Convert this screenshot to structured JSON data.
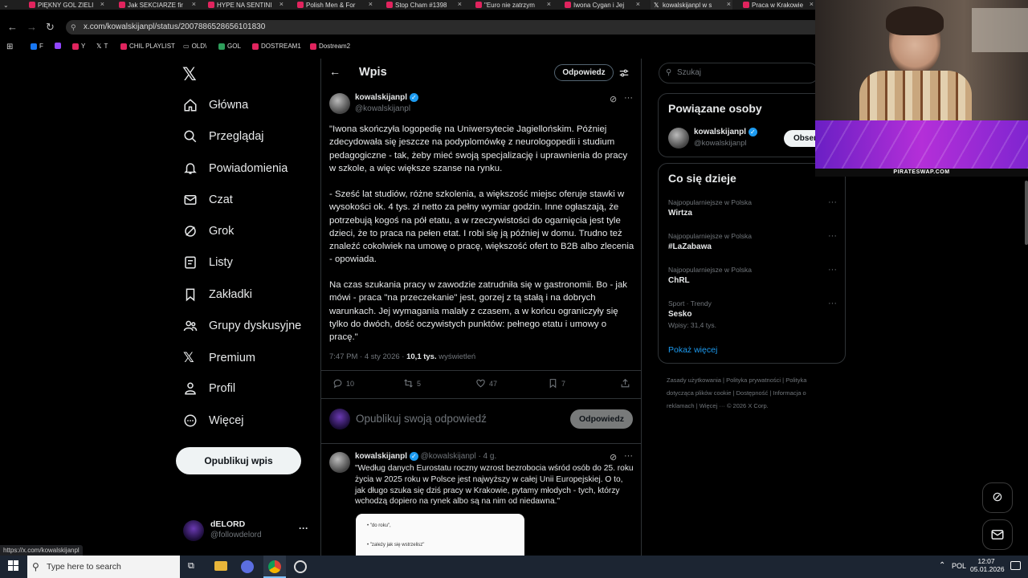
{
  "browser": {
    "tabs": [
      {
        "label": "PIĘKNY GOL ZIELI"
      },
      {
        "label": "Jak SEKCIARZE fir"
      },
      {
        "label": "HYPE NA SENTINI"
      },
      {
        "label": "Polish Men & For"
      },
      {
        "label": "Stop Cham #1398"
      },
      {
        "label": "\"Euro nie zatrzym"
      },
      {
        "label": "Iwona Cygan i Jej"
      },
      {
        "label": "kowalskijanpl w s"
      },
      {
        "label": "Praca w Krakowie"
      }
    ],
    "url": "x.com/kowalskijanpl/status/2007886528656101830",
    "bookmarks": [
      "F",
      "Y",
      "T",
      "CHIL PLAYLIST",
      "OLD\\",
      "GOL",
      "DOSTREAM1",
      "Dostream2"
    ],
    "status_url": "https://x.com/kowalskijanpl"
  },
  "nav": {
    "items": [
      {
        "label": "Główna",
        "icon": "home-icon"
      },
      {
        "label": "Przeglądaj",
        "icon": "search-icon"
      },
      {
        "label": "Powiadomienia",
        "icon": "bell-icon"
      },
      {
        "label": "Czat",
        "icon": "mail-icon"
      },
      {
        "label": "Grok",
        "icon": "grok-icon"
      },
      {
        "label": "Listy",
        "icon": "list-icon"
      },
      {
        "label": "Zakładki",
        "icon": "bookmark-icon"
      },
      {
        "label": "Grupy dyskusyjne",
        "icon": "people-icon"
      },
      {
        "label": "Premium",
        "icon": "x-logo-icon"
      },
      {
        "label": "Profil",
        "icon": "person-icon"
      },
      {
        "label": "Więcej",
        "icon": "more-circle-icon"
      }
    ],
    "post_button": "Opublikuj wpis",
    "account": {
      "name": "dELORD",
      "handle": "@followdelord"
    }
  },
  "header": {
    "title": "Wpis",
    "reply_button": "Odpowiedz"
  },
  "tweet": {
    "author": "kowalskijanpl",
    "handle": "@kowalskijanpl",
    "paragraphs": [
      "\"Iwona skończyła logopedię na Uniwersytecie Jagiellońskim. Później zdecydowała się jeszcze na podyplomówkę z neurologopedii i studium pedagogiczne - tak, żeby mieć swoją specjalizację i uprawnienia do pracy w szkole, a więc większe szanse na rynku.",
      "- Sześć lat studiów, różne szkolenia, a większość miejsc oferuje stawki w wysokości ok. 4 tys. zł netto za pełny wymiar godzin. Inne ogłaszają, że potrzebują kogoś na pół etatu, a w rzeczywistości do ogarnięcia jest tyle dzieci, że to praca na pełen etat. I robi się ją później w domu. Trudno też znaleźć cokolwiek na umowę o pracę, większość ofert to B2B albo zlecenia - opowiada.",
      "Na czas szukania pracy w zawodzie zatrudniła się w gastronomii. Bo - jak mówi - praca \"na przeczekanie\" jest, gorzej z tą stałą i na dobrych warunkach. Jej wymagania malały z czasem, a w końcu ograniczyły się tylko do dwóch, dość oczywistych punktów: pełnego etatu i umowy o pracę.\""
    ],
    "time": "7:47 PM · 4 sty 2026 · ",
    "views": "10,1 tys.",
    "views_label": " wyświetleń",
    "replies": "10",
    "retweets": "5",
    "likes": "47",
    "bookmarks": "7"
  },
  "reply_box": {
    "placeholder": "Opublikuj swoją odpowiedź",
    "button": "Odpowiedz"
  },
  "second_tweet": {
    "author": "kowalskijanpl",
    "handle_time": "@kowalskijanpl · 4 g.",
    "text": "\"Według danych Eurostatu roczny wzrost bezrobocia wśród osób do 25. roku życia w 2025 roku w Polsce jest najwyższy w całej Unii Europejskiej. O to, jak długo szuka się dziś pracy w Krakowie, pytamy młodych - tych, którzy wchodzą dopiero na rynek albo są na nim od niedawna.\"",
    "card_lines": [
      "\"do roku\",",
      "\"zależy jak się wstrzelisz\""
    ]
  },
  "right": {
    "search_placeholder": "Szukaj",
    "related_title": "Powiązane osoby",
    "related_person": {
      "name": "kowalskijanpl",
      "handle": "@kowalskijanpl",
      "follow": "Obser"
    },
    "trends_title": "Co się dzieje",
    "trends": [
      {
        "category": "Najpopularniejsze w Polska",
        "name": "Wirtza",
        "posts": ""
      },
      {
        "category": "Najpopularniejsze w Polska",
        "name": "#LaZabawa",
        "posts": ""
      },
      {
        "category": "Najpopularniejsze w Polska",
        "name": "ChRL",
        "posts": ""
      },
      {
        "category": "Sport · Trendy",
        "name": "Sesko",
        "posts": "Wpisy: 31,4 tys."
      }
    ],
    "show_more": "Pokaż więcej",
    "footer": [
      "Zasady użytkowania",
      "|",
      "Polityka prywatności",
      "|",
      "Polityka dotycząca plików cookie",
      "|",
      "Dostępność",
      "|",
      "Informacja o reklamach",
      "|",
      "Więcej ···",
      "© 2026 X Corp."
    ]
  },
  "overlay": {
    "promo_text": "PIRATESWAP.COM"
  },
  "taskbar": {
    "search": "Type here to search",
    "lang": "POL",
    "time": "12:07",
    "date": "05.01.2026"
  },
  "colors": {
    "accent": "#1d9bf0",
    "bg": "#000000",
    "border": "#2f3336",
    "muted": "#71767b"
  }
}
